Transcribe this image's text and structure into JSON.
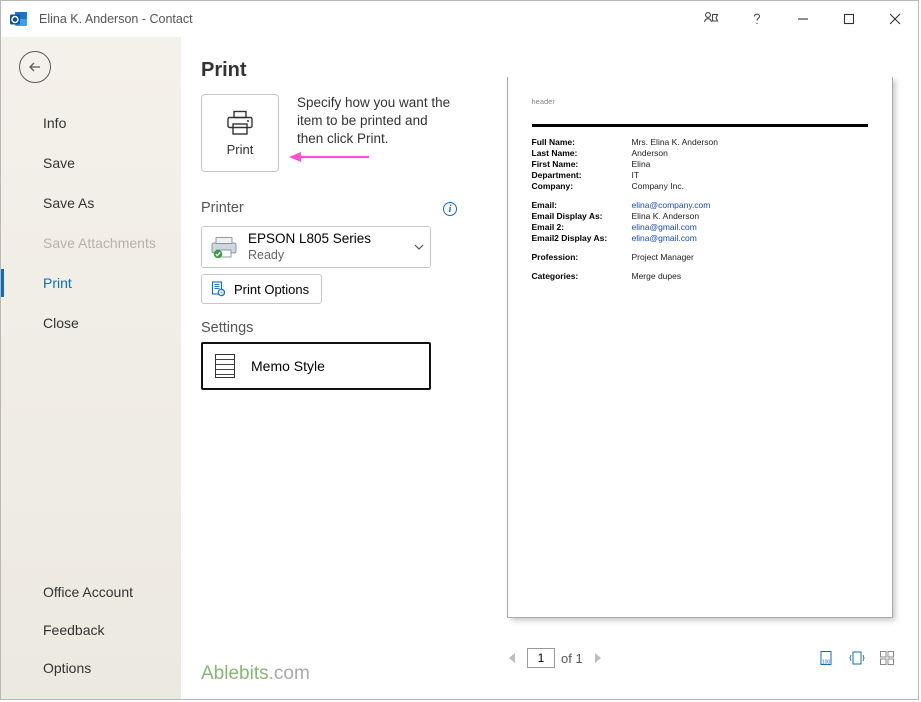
{
  "titlebar": {
    "title": "Elina K. Anderson  -  Contact"
  },
  "sidebar": {
    "items": [
      {
        "label": "Info"
      },
      {
        "label": "Save"
      },
      {
        "label": "Save As"
      },
      {
        "label": "Save Attachments",
        "disabled": true
      },
      {
        "label": "Print",
        "selected": true
      },
      {
        "label": "Close"
      }
    ],
    "bottom": [
      {
        "label": "Office Account"
      },
      {
        "label": "Feedback"
      },
      {
        "label": "Options"
      }
    ]
  },
  "main": {
    "title": "Print",
    "print_button_label": "Print",
    "description": "Specify how you want the item to be printed and then click Print.",
    "printer_section": "Printer",
    "printer": {
      "name": "EPSON L805 Series",
      "status": "Ready"
    },
    "print_options": "Print Options",
    "settings_section": "Settings",
    "style": "Memo Style",
    "watermark_left": "Ablebits",
    "watermark_right": ".com"
  },
  "preview": {
    "header": "header",
    "rows": [
      [
        {
          "label": "Full Name:",
          "value": "Mrs. Elina K. Anderson"
        },
        {
          "label": "Last Name:",
          "value": "Anderson"
        },
        {
          "label": "First Name:",
          "value": "Elina"
        },
        {
          "label": "Department:",
          "value": "IT"
        },
        {
          "label": "Company:",
          "value": "Company Inc."
        }
      ],
      [
        {
          "label": "Email:",
          "value": "elina@company.com",
          "link": true
        },
        {
          "label": "Email Display As:",
          "value": "Elina K. Anderson"
        },
        {
          "label": "Email 2:",
          "value": "elina@gmail.com",
          "link": true
        },
        {
          "label": "Email2 Display As:",
          "value": "elina@gmail.com",
          "link": true
        }
      ],
      [
        {
          "label": "Profession:",
          "value": "Project Manager"
        }
      ],
      [
        {
          "label": "Categories:",
          "value": "Merge dupes"
        }
      ]
    ],
    "pager": {
      "current": "1",
      "total_label": "of 1"
    }
  }
}
